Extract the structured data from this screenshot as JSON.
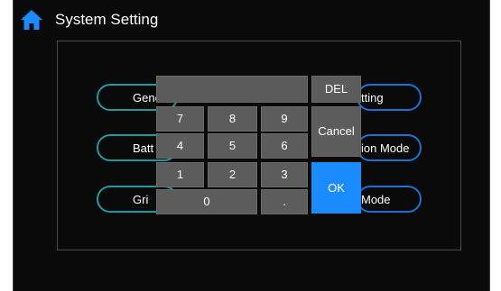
{
  "header": {
    "title": "System Setting",
    "icon": "home-icon",
    "icon_color": "#1a8cff"
  },
  "menu": {
    "left": [
      "Gene",
      "Batt",
      "Gri"
    ],
    "right": [
      "tting",
      "ion Mode",
      "Mode"
    ]
  },
  "keypad": {
    "display_value": "",
    "keys": [
      "7",
      "8",
      "9",
      "4",
      "5",
      "6",
      "1",
      "2",
      "3",
      "0",
      "."
    ],
    "del": "DEL",
    "cancel": "Cancel",
    "ok": "OK"
  },
  "colors": {
    "accent_blue": "#1a8cff",
    "teal": "#1f9ba0",
    "key_gray": "#5c5c5c"
  }
}
